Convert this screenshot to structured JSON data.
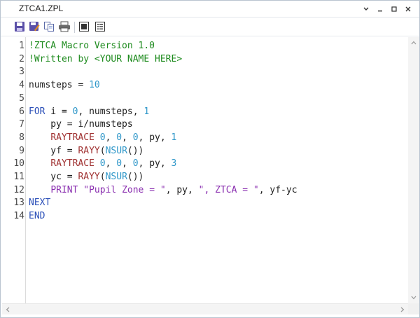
{
  "window": {
    "title": "ZTCA1.ZPL",
    "controls": [
      "chevron-down-icon",
      "minimize-icon",
      "restore-icon",
      "close-icon"
    ]
  },
  "toolbar": {
    "buttons": [
      "save-icon",
      "save-as-icon",
      "copy-icon",
      "print-icon",
      "view-icon",
      "line-numbers-icon"
    ]
  },
  "editor": {
    "line_numbers": [
      "1",
      "2",
      "3",
      "4",
      "5",
      "6",
      "7",
      "8",
      "9",
      "10",
      "11",
      "12",
      "13",
      "14"
    ],
    "lines": [
      [
        {
          "t": "!ZTCA Macro Version 1.0",
          "c": "comment"
        }
      ],
      [
        {
          "t": "!Written by <YOUR NAME HERE>",
          "c": "comment"
        }
      ],
      [],
      [
        {
          "t": "numsteps = ",
          "c": "plain"
        },
        {
          "t": "10",
          "c": "num"
        }
      ],
      [],
      [
        {
          "t": "FOR",
          "c": "kw"
        },
        {
          "t": " i = ",
          "c": "plain"
        },
        {
          "t": "0",
          "c": "num"
        },
        {
          "t": ", numsteps, ",
          "c": "plain"
        },
        {
          "t": "1",
          "c": "num"
        }
      ],
      [
        {
          "t": "    py = i/numsteps",
          "c": "plain"
        }
      ],
      [
        {
          "t": "    ",
          "c": "plain"
        },
        {
          "t": "RAYTRACE",
          "c": "fn"
        },
        {
          "t": " ",
          "c": "plain"
        },
        {
          "t": "0",
          "c": "num"
        },
        {
          "t": ", ",
          "c": "plain"
        },
        {
          "t": "0",
          "c": "num"
        },
        {
          "t": ", ",
          "c": "plain"
        },
        {
          "t": "0",
          "c": "num"
        },
        {
          "t": ", py, ",
          "c": "plain"
        },
        {
          "t": "1",
          "c": "num"
        }
      ],
      [
        {
          "t": "    yf = ",
          "c": "plain"
        },
        {
          "t": "RAYY",
          "c": "fn"
        },
        {
          "t": "(",
          "c": "plain"
        },
        {
          "t": "NSUR",
          "c": "fn2"
        },
        {
          "t": "())",
          "c": "plain"
        }
      ],
      [
        {
          "t": "    ",
          "c": "plain"
        },
        {
          "t": "RAYTRACE",
          "c": "fn"
        },
        {
          "t": " ",
          "c": "plain"
        },
        {
          "t": "0",
          "c": "num"
        },
        {
          "t": ", ",
          "c": "plain"
        },
        {
          "t": "0",
          "c": "num"
        },
        {
          "t": ", ",
          "c": "plain"
        },
        {
          "t": "0",
          "c": "num"
        },
        {
          "t": ", py, ",
          "c": "plain"
        },
        {
          "t": "3",
          "c": "num"
        }
      ],
      [
        {
          "t": "    yc = ",
          "c": "plain"
        },
        {
          "t": "RAYY",
          "c": "fn"
        },
        {
          "t": "(",
          "c": "plain"
        },
        {
          "t": "NSUR",
          "c": "fn2"
        },
        {
          "t": "())",
          "c": "plain"
        }
      ],
      [
        {
          "t": "    ",
          "c": "plain"
        },
        {
          "t": "PRINT",
          "c": "print"
        },
        {
          "t": " ",
          "c": "plain"
        },
        {
          "t": "\"Pupil Zone = \"",
          "c": "str"
        },
        {
          "t": ", py, ",
          "c": "plain"
        },
        {
          "t": "\", ZTCA = \"",
          "c": "str"
        },
        {
          "t": ", yf-yc",
          "c": "plain"
        }
      ],
      [
        {
          "t": "NEXT",
          "c": "kw"
        }
      ],
      [
        {
          "t": "END",
          "c": "kw"
        }
      ]
    ]
  }
}
